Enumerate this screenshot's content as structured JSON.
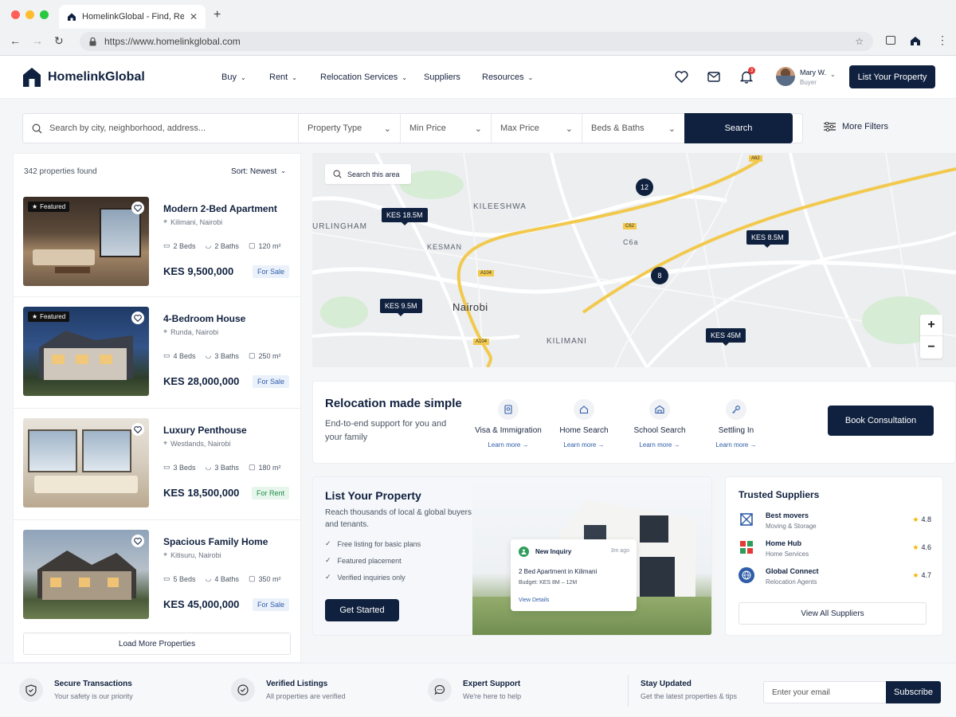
{
  "browser": {
    "tab_title": "HomelinkGlobal - Find, Rent, Bu",
    "url": "https://www.homelinkglobal.com"
  },
  "header": {
    "logo_text": "HomelinkGlobal",
    "nav": [
      "Buy",
      "Rent",
      "Relocation Services",
      "Suppliers",
      "Resources"
    ],
    "notification_count": "3",
    "user_name": "Mary W.",
    "user_role": "Buyer",
    "cta": "List Your Property"
  },
  "search": {
    "placeholder": "Search by city, neighborhood, address...",
    "property_type": "Property Type",
    "min_price": "Min Price",
    "max_price": "Max Price",
    "beds_baths": "Beds & Baths",
    "button": "Search",
    "more_filters": "More Filters"
  },
  "listings": {
    "count_text": "342 properties found",
    "sort_text": "Sort: Newest",
    "featured_label": "Featured",
    "load_more": "Load More Properties",
    "items": [
      {
        "name": "Modern 2-Bed Apartment",
        "location": "Kilimani, Nairobi",
        "beds": "2 Beds",
        "baths": "2 Baths",
        "area": "120 m²",
        "price": "KES 9,500,000",
        "tag": "For Sale"
      },
      {
        "name": "4-Bedroom House",
        "location": "Runda, Nairobi",
        "beds": "4 Beds",
        "baths": "3 Baths",
        "area": "250 m²",
        "price": "KES 28,000,000",
        "tag": "For Sale"
      },
      {
        "name": "Luxury Penthouse",
        "location": "Westlands, Nairobi",
        "beds": "3 Beds",
        "baths": "3 Baths",
        "area": "180 m²",
        "price": "KES 18,500,000",
        "tag": "For Rent"
      },
      {
        "name": "Spacious Family Home",
        "location": "Kitisuru, Nairobi",
        "beds": "5 Beds",
        "baths": "4 Baths",
        "area": "350 m²",
        "price": "KES 45,000,000",
        "tag": "For Sale"
      }
    ]
  },
  "map": {
    "search_area": "Search this area",
    "labels": [
      "KILEESHWA",
      "URLINGHAM",
      "Nairobi",
      "KILIMANI",
      "KESMAN",
      "C6a"
    ],
    "road_labels": [
      "A62",
      "C62",
      "A104",
      "A104"
    ],
    "pins": [
      "KES 18.5M",
      "KES 8.5M",
      "KES 9.5M",
      "KES 45M"
    ],
    "clusters": [
      "12",
      "8"
    ],
    "zoom_in": "+",
    "zoom_out": "−"
  },
  "relocation": {
    "title": "Relocation made simple",
    "subtitle": "End-to-end support for you and your family",
    "learn_more": "Learn more →",
    "services": [
      "Visa & Immigration",
      "Home Search",
      "School Search",
      "Settling In"
    ],
    "button": "Book Consultation"
  },
  "list_property": {
    "title": "List Your Property",
    "subtitle": "Reach thousands of local & global buyers and tenants.",
    "checks": [
      "Free listing for basic plans",
      "Featured placement",
      "Verified inquiries only"
    ],
    "button": "Get Started",
    "inquiry": {
      "title": "New Inquiry",
      "time": "3m ago",
      "property": "2 Bed Apartment in Kilimani",
      "budget": "Budget: KES 8M – 12M",
      "link": "View Details"
    }
  },
  "suppliers": {
    "title": "Trusted Suppliers",
    "items": [
      {
        "name": "Best movers",
        "category": "Moving & Storage",
        "rating": "4.8"
      },
      {
        "name": "Home Hub",
        "category": "Home Services",
        "rating": "4.6"
      },
      {
        "name": "Global Connect",
        "category": "Relocation Agents",
        "rating": "4.7"
      }
    ],
    "button": "View All Suppliers"
  },
  "footer": {
    "features": [
      {
        "title": "Secure Transactions",
        "text": "Your safety is our priority"
      },
      {
        "title": "Verified Listings",
        "text": "All properties are verified"
      },
      {
        "title": "Expert Support",
        "text": "We're here to help"
      }
    ],
    "newsletter_title": "Stay Updated",
    "newsletter_text": "Get the latest properties & tips",
    "email_placeholder": "Enter your email",
    "subscribe": "Subscribe"
  },
  "colors": {
    "navy": "#10213f",
    "accent": "#f5b400",
    "link": "#2f5da8"
  }
}
